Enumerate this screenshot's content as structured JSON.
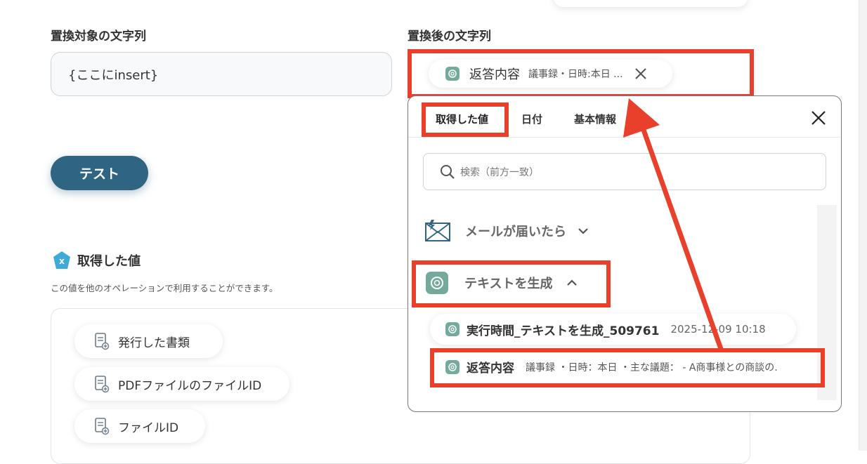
{
  "left": {
    "target_label": "置換対象の文字列",
    "target_value": "{ここにinsert}",
    "test_button": "テスト",
    "acquired_title": "取得した値",
    "acquired_desc": "この値を他のオペレーションで利用することができます。",
    "outputs": [
      {
        "label": "発行した書類"
      },
      {
        "label": "PDFファイルのファイルID"
      },
      {
        "label": "ファイルID"
      }
    ]
  },
  "right": {
    "replaced_label": "置換後の文字列",
    "chip": {
      "title": "返答内容",
      "preview": "議事録・日時:本日 ..."
    }
  },
  "panel": {
    "tabs": [
      "取得した値",
      "日付",
      "基本情報"
    ],
    "search_placeholder": "検索（前方一致）",
    "sections": [
      {
        "title": "メールが届いたら",
        "state": "collapsed"
      },
      {
        "title": "テキストを生成",
        "state": "expanded"
      }
    ],
    "items": [
      {
        "title": "実行時間_テキストを生成_509761",
        "value": "2025-12-09 10:18"
      },
      {
        "title": "返答内容",
        "value": "議事録 ・日時：本日 ・主な議題： - A商事様との商談の."
      }
    ]
  },
  "colors": {
    "accent": "#2f6482",
    "highlight": "#e8402a",
    "gpt": "#74aa9c"
  }
}
